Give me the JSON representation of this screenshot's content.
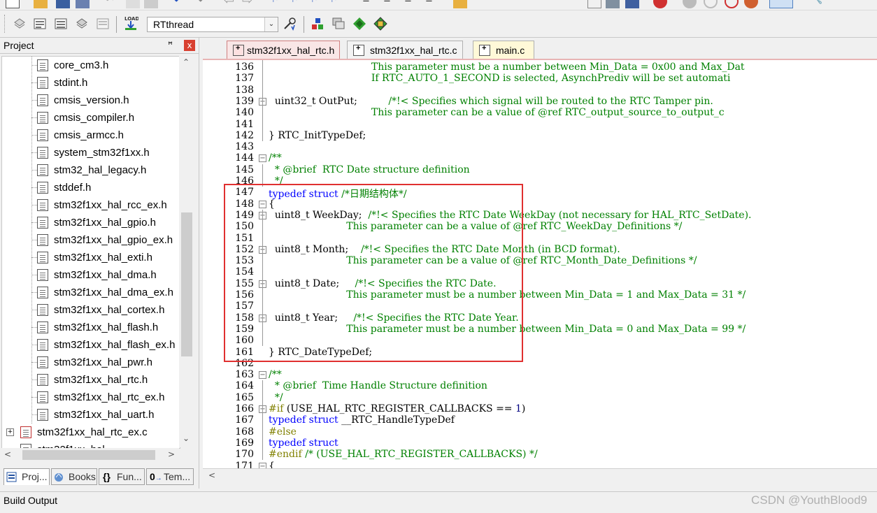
{
  "toolbar": {
    "target_combo": "RTthread"
  },
  "project_panel": {
    "title": "Project",
    "pin_glyph": "ꟸ",
    "close_glyph": "x",
    "tree_items": [
      "core_cm3.h",
      "stdint.h",
      "cmsis_version.h",
      "cmsis_compiler.h",
      "cmsis_armcc.h",
      "system_stm32f1xx.h",
      "stm32_hal_legacy.h",
      "stddef.h",
      "stm32f1xx_hal_rcc_ex.h",
      "stm32f1xx_hal_gpio.h",
      "stm32f1xx_hal_gpio_ex.h",
      "stm32f1xx_hal_exti.h",
      "stm32f1xx_hal_dma.h",
      "stm32f1xx_hal_dma_ex.h",
      "stm32f1xx_hal_cortex.h",
      "stm32f1xx_hal_flash.h",
      "stm32f1xx_hal_flash_ex.h",
      "stm32f1xx_hal_pwr.h",
      "stm32f1xx_hal_rtc.h",
      "stm32f1xx_hal_rtc_ex.h",
      "stm32f1xx_hal_uart.h"
    ],
    "group_item": "stm32f1xx_hal_rtc_ex.c",
    "partial_item": "stm32f1xx_hal",
    "tabs": [
      "Proj...",
      "Books",
      "Fun...",
      "Tem..."
    ]
  },
  "editor_tabs": [
    "stm32f1xx_hal_rtc.h",
    "stm32f1xx_hal_rtc.c",
    "main.c"
  ],
  "code_lines": [
    {
      "n": "136",
      "html": "                                 <span class=\"c\">This parameter must be a number between Min_Data = 0x00 and Max_Dat</span>"
    },
    {
      "n": "137",
      "html": "                                 <span class=\"c\">If RTC_AUTO_1_SECOND is selected, AsynchPrediv will be set automati</span>"
    },
    {
      "n": "138",
      "html": ""
    },
    {
      "n": "139",
      "html": "  uint32_t OutPut;          <span class=\"c\">/*!&lt; Specifies which signal will be routed to the RTC Tamper pin.</span>"
    },
    {
      "n": "140",
      "html": "                                 <span class=\"c\">This parameter can be a value of @ref RTC_output_source_to_output_c</span>"
    },
    {
      "n": "141",
      "html": ""
    },
    {
      "n": "142",
      "html": "} RTC_InitTypeDef;"
    },
    {
      "n": "143",
      "html": ""
    },
    {
      "n": "144",
      "html": "<span class=\"c\">/**</span>"
    },
    {
      "n": "145",
      "html": "<span class=\"c\">  * @brief  RTC Date structure definition</span>"
    },
    {
      "n": "146",
      "html": "<span class=\"c\">  */</span>"
    },
    {
      "n": "147",
      "html": "<span class=\"k\">typedef</span> <span class=\"k\">struct</span> <span class=\"c\">/*日期结构体*/</span>"
    },
    {
      "n": "148",
      "html": "{"
    },
    {
      "n": "149",
      "html": "  uint8_t WeekDay;  <span class=\"c\">/*!&lt; Specifies the RTC Date WeekDay (not necessary for HAL_RTC_SetDate).</span>"
    },
    {
      "n": "150",
      "html": "                         <span class=\"c\">This parameter can be a value of @ref RTC_WeekDay_Definitions */</span>"
    },
    {
      "n": "151",
      "html": ""
    },
    {
      "n": "152",
      "html": "  uint8_t Month;    <span class=\"c\">/*!&lt; Specifies the RTC Date Month (in BCD format).</span>"
    },
    {
      "n": "153",
      "html": "                         <span class=\"c\">This parameter can be a value of @ref RTC_Month_Date_Definitions */</span>"
    },
    {
      "n": "154",
      "html": ""
    },
    {
      "n": "155",
      "html": "  uint8_t Date;     <span class=\"c\">/*!&lt; Specifies the RTC Date.</span>"
    },
    {
      "n": "156",
      "html": "                         <span class=\"c\">This parameter must be a number between Min_Data = 1 and Max_Data = 31 */</span>"
    },
    {
      "n": "157",
      "html": ""
    },
    {
      "n": "158",
      "html": "  uint8_t Year;     <span class=\"c\">/*!&lt; Specifies the RTC Date Year.</span>"
    },
    {
      "n": "159",
      "html": "                         <span class=\"c\">This parameter must be a number between Min_Data = 0 and Max_Data = 99 */</span>"
    },
    {
      "n": "160",
      "html": ""
    },
    {
      "n": "161",
      "html": "} RTC_DateTypeDef;"
    },
    {
      "n": "162",
      "html": ""
    },
    {
      "n": "163",
      "html": "<span class=\"c\">/**</span>"
    },
    {
      "n": "164",
      "html": "<span class=\"c\">  * @brief  Time Handle Structure definition</span>"
    },
    {
      "n": "165",
      "html": "<span class=\"c\">  */</span>"
    },
    {
      "n": "166",
      "html": "<span class=\"pp\">#if</span> (USE_HAL_RTC_REGISTER_CALLBACKS == <span class=\"num\">1</span>)"
    },
    {
      "n": "167",
      "html": "<span class=\"k\">typedef</span> <span class=\"k\">struct</span> __RTC_HandleTypeDef"
    },
    {
      "n": "168",
      "html": "<span class=\"pp\">#else</span>"
    },
    {
      "n": "169",
      "html": "<span class=\"k\">typedef</span> <span class=\"k\">struct</span>"
    },
    {
      "n": "170",
      "html": "<span class=\"pp\">#endif</span> <span class=\"c\">/* (USE_HAL_RTC_REGISTER_CALLBACKS) */</span>"
    },
    {
      "n": "171",
      "html": "{"
    }
  ],
  "build_output_label": "Build Output",
  "watermark": "CSDN @YouthBlood9"
}
